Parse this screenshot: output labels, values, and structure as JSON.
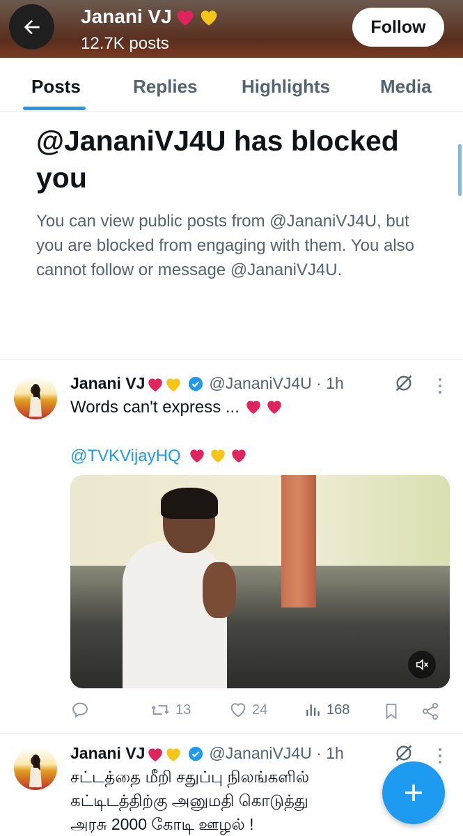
{
  "header": {
    "display_name": "Janani VJ",
    "post_count": "12.7K posts",
    "follow_label": "Follow"
  },
  "tabs": [
    {
      "label": "Posts",
      "active": true
    },
    {
      "label": "Replies",
      "active": false
    },
    {
      "label": "Highlights",
      "active": false
    },
    {
      "label": "Media",
      "active": false
    }
  ],
  "blocked_notice": {
    "title": "@JananiVJ4U has blocked you",
    "description": "You can view public posts from @JananiVJ4U, but you are blocked from engaging with them. You also cannot follow or message @JananiVJ4U."
  },
  "posts": [
    {
      "author_name": "Janani VJ",
      "handle_time": "@JananiVJ4U · 1h",
      "text_line1": "Words can't express ...",
      "mention": "@TVKVijayHQ",
      "metrics": {
        "replies": "",
        "reposts": "13",
        "likes": "24",
        "views": "168"
      }
    },
    {
      "author_name": "Janani VJ",
      "handle_time": "@JananiVJ4U · 1h",
      "text_line1": "சட்டத்தை மீறி சதுப்பு நிலங்களில்",
      "text_line2": "கட்டிடத்திற்கு அனுமதி கொடுத்து",
      "text_line3": "அரசு 2000 கோடி ஊழல் !"
    }
  ],
  "icons": {
    "back": "arrow-left-icon",
    "verified": "verified-badge-icon",
    "grok": "grok-icon",
    "more": "more-dots-icon",
    "reply": "reply-icon",
    "repost": "repost-icon",
    "like": "heart-icon",
    "views": "views-icon",
    "bookmark": "bookmark-icon",
    "share": "share-icon",
    "compose": "plus-icon",
    "mute": "speaker-muted-icon"
  },
  "colors": {
    "accent": "#1d9bf0",
    "muted_text": "#536471",
    "heart_red": "#e0245e",
    "heart_yellow": "#f5c518"
  }
}
